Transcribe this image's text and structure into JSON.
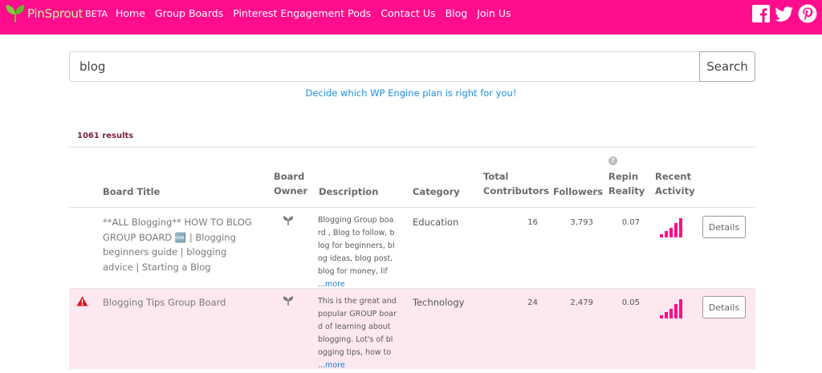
{
  "brand": {
    "name": "PinSprout",
    "badge": "BETA",
    "accent": "#ff0d8c"
  },
  "nav": {
    "items": [
      {
        "label": "Home"
      },
      {
        "label": "Group Boards"
      },
      {
        "label": "Pinterest Engagement Pods"
      },
      {
        "label": "Contact Us"
      },
      {
        "label": "Blog"
      },
      {
        "label": "Join Us"
      }
    ]
  },
  "social": [
    "facebook-icon",
    "twitter-icon",
    "pinterest-icon"
  ],
  "search": {
    "value": "blog",
    "button_label": "Search"
  },
  "promo": {
    "text": "Decide which WP Engine plan is right for you!"
  },
  "results": {
    "count_text": "1061 results"
  },
  "table": {
    "headers": {
      "title": "Board Title",
      "owner_l1": "Board",
      "owner_l2": "Owner",
      "description": "Description",
      "category": "Category",
      "contributors_l1": "Total",
      "contributors_l2": "Contributors",
      "followers": "Followers",
      "repin_l1": "Repin",
      "repin_l2": "Reality",
      "activity_l1": "Recent",
      "activity_l2": "Activity",
      "help_icon": "?"
    },
    "rows": [
      {
        "title": "**ALL Blogging** HOW TO BLOG GROUP BOARD 🆒 | Blogging beginners guide | blogging advice | Starting a Blog",
        "description": "Blogging Group board , Blog to follow, blog for beginners, blog ideas, blog post, blog for money, lif ",
        "more": "...more",
        "category": "Education",
        "contributors": "16",
        "followers": "3,793",
        "repin": "0.07",
        "activity_level": 5,
        "details_label": "Details",
        "flagged": false
      },
      {
        "title": "Blogging Tips Group Board",
        "description": "This is the great and popular GROUP board of learning about blogging. Lot's of blogging tips, how to ",
        "more": "...more",
        "category": "Technology",
        "contributors": "24",
        "followers": "2,479",
        "repin": "0.05",
        "activity_level": 5,
        "details_label": "Details",
        "flagged": true
      }
    ]
  }
}
